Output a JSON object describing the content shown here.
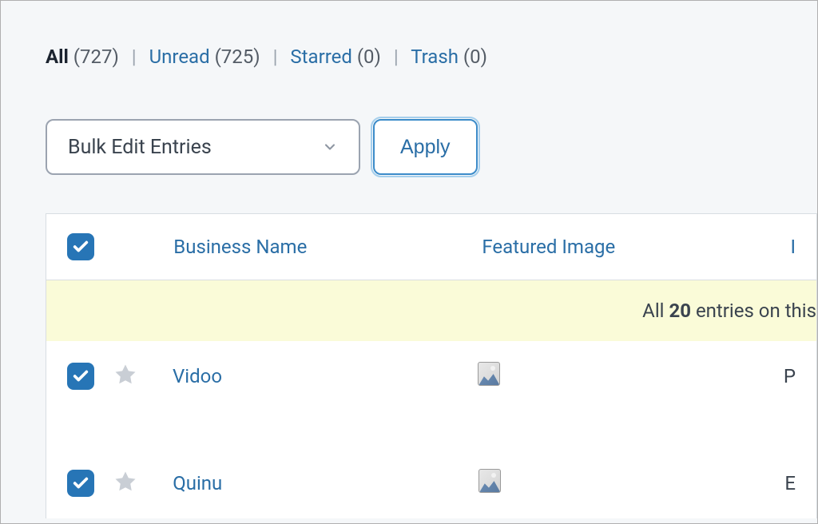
{
  "filters": {
    "all_label": "All",
    "all_count": "(727)",
    "unread_label": "Unread",
    "unread_count": "(725)",
    "starred_label": "Starred",
    "starred_count": "(0)",
    "trash_label": "Trash",
    "trash_count": "(0)"
  },
  "bulk": {
    "select_label": "Bulk Edit Entries",
    "apply_label": "Apply"
  },
  "table": {
    "headers": {
      "business_name": "Business Name",
      "featured_image": "Featured Image",
      "trailing": "I"
    },
    "selection_banner": {
      "pre": "All ",
      "count": "20",
      "post": " entries on this"
    },
    "rows": [
      {
        "name": "Vidoo",
        "trail": "P"
      },
      {
        "name": "Quinu",
        "trail": "E"
      }
    ]
  }
}
